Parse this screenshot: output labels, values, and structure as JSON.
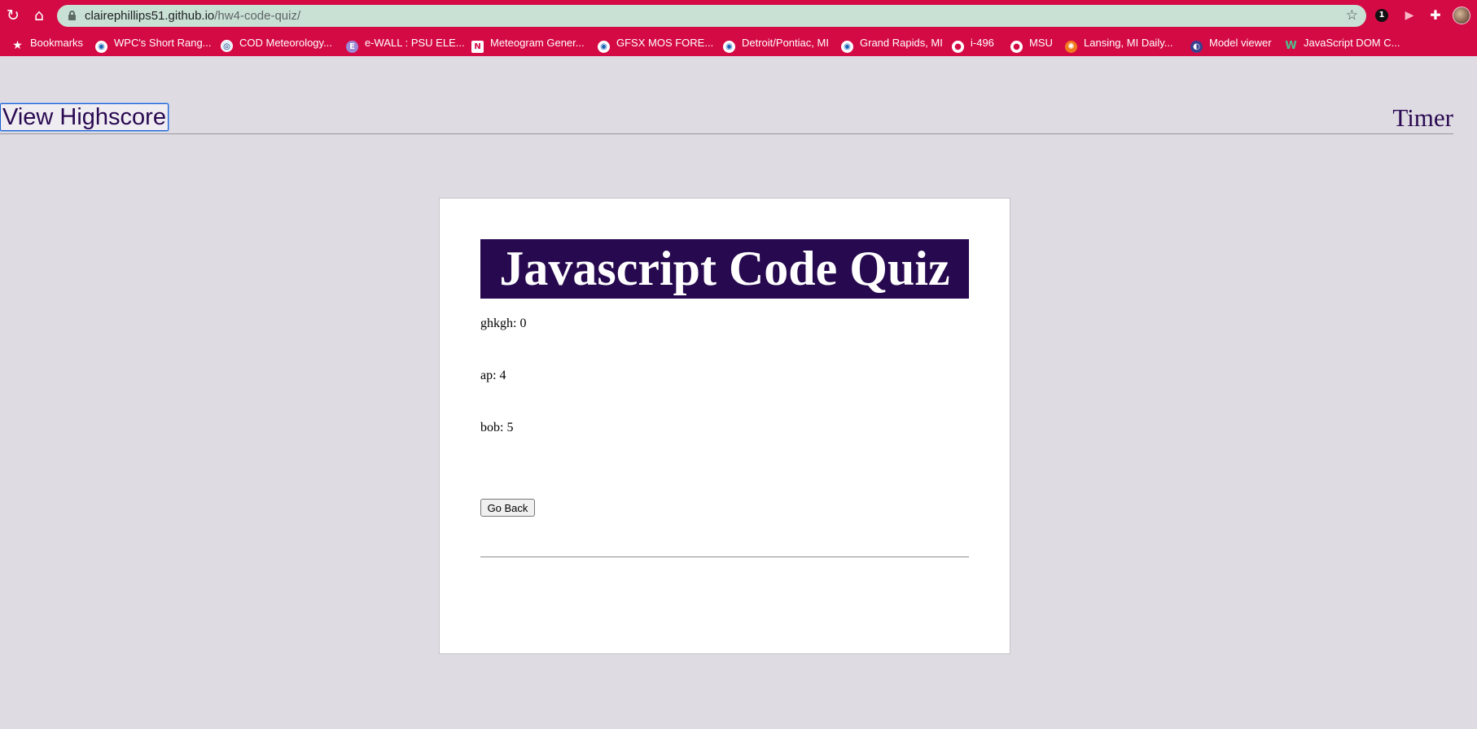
{
  "browser": {
    "url_host": "clairephillips51.github.io",
    "url_path": "/hw4-code-quiz/",
    "extension_badge": "1",
    "bookmarks": [
      {
        "label": "Bookmarks",
        "icon": "star-icon"
      },
      {
        "label": "WPC's Short Rang...",
        "icon": "noaa-icon"
      },
      {
        "label": "COD Meteorology...",
        "icon": "cod-icon"
      },
      {
        "label": "e-WALL : PSU ELE...",
        "icon": "e-icon"
      },
      {
        "label": "Meteogram Gener...",
        "icon": "n-icon"
      },
      {
        "label": "GFSX MOS FORE...",
        "icon": "noaa-icon"
      },
      {
        "label": "Detroit/Pontiac, MI",
        "icon": "noaa-icon"
      },
      {
        "label": "Grand Rapids, MI",
        "icon": "noaa-icon"
      },
      {
        "label": "i-496",
        "icon": "globe-icon"
      },
      {
        "label": "MSU",
        "icon": "globe-icon"
      },
      {
        "label": "Lansing, MI Daily...",
        "icon": "lansing-icon"
      },
      {
        "label": "Model viewer",
        "icon": "model-icon"
      },
      {
        "label": "JavaScript DOM C...",
        "icon": "w-icon"
      }
    ]
  },
  "header": {
    "view_highscore_label": "View Highscore",
    "timer_label": "Timer"
  },
  "main": {
    "title": "Javascript Code Quiz",
    "scores": [
      "ghkgh: 0",
      "ap: 4",
      "bob: 5"
    ],
    "go_back_label": "Go Back"
  },
  "colors": {
    "chrome": "#d40a45",
    "omnibox": "#c9e1d5",
    "page_background": "#dedbe2",
    "title_background": "#27094f",
    "header_text": "#2a0a52"
  }
}
